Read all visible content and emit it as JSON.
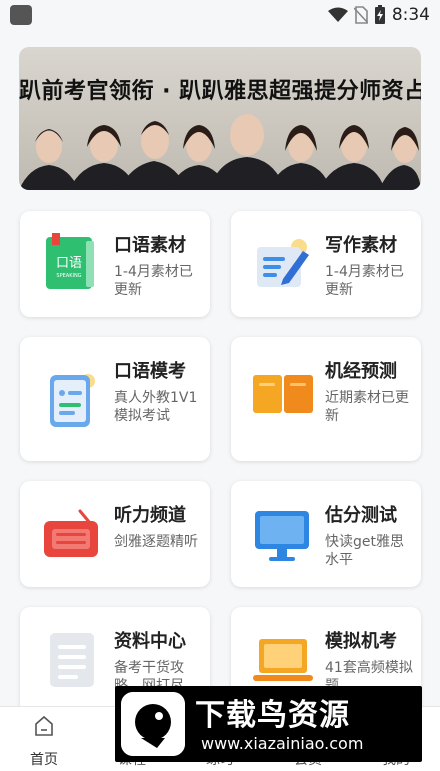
{
  "status": {
    "time": "8:34"
  },
  "banner": {
    "title": "趴前考官领衔 · 趴趴雅思超强提分师资占"
  },
  "cards": [
    {
      "title": "口语素材",
      "subtitle": "1-4月素材已更新",
      "icon": "speaking-book-icon",
      "icon_text": "口语",
      "icon_subtext": "SPEAKING"
    },
    {
      "title": "写作素材",
      "subtitle": "1-4月素材已更新",
      "icon": "writing-pen-icon"
    },
    {
      "title": "口语模考",
      "subtitle": "真人外教1V1模拟考试",
      "icon": "phone-card-icon"
    },
    {
      "title": "机经预测",
      "subtitle": "近期素材已更新",
      "icon": "open-book-icon"
    },
    {
      "title": "听力频道",
      "subtitle": "剑雅逐题精听",
      "icon": "radio-icon"
    },
    {
      "title": "估分测试",
      "subtitle": "快读get雅思水平",
      "icon": "monitor-icon"
    },
    {
      "title": "资料中心",
      "subtitle": "备考干货攻略，网打尽",
      "icon": "document-icon"
    },
    {
      "title": "模拟机考",
      "subtitle": "41套高频模拟题",
      "icon": "laptop-icon"
    }
  ],
  "tabs": [
    {
      "label": "首页",
      "icon": "home-icon",
      "active": true
    },
    {
      "label": "课程",
      "icon": "course-icon"
    },
    {
      "label": "练习",
      "icon": "practice-icon"
    },
    {
      "label": "会员",
      "icon": "member-icon"
    },
    {
      "label": "我的",
      "icon": "profile-icon"
    }
  ],
  "watermark": {
    "main": "下载鸟资源",
    "url": "www.xiazainiao.com"
  },
  "colors": {
    "speaking": "#2fbf71",
    "writing": "#3d8ee8",
    "exam": "#f5a623",
    "radio": "#e8453c",
    "monitor": "#2d87e2"
  }
}
